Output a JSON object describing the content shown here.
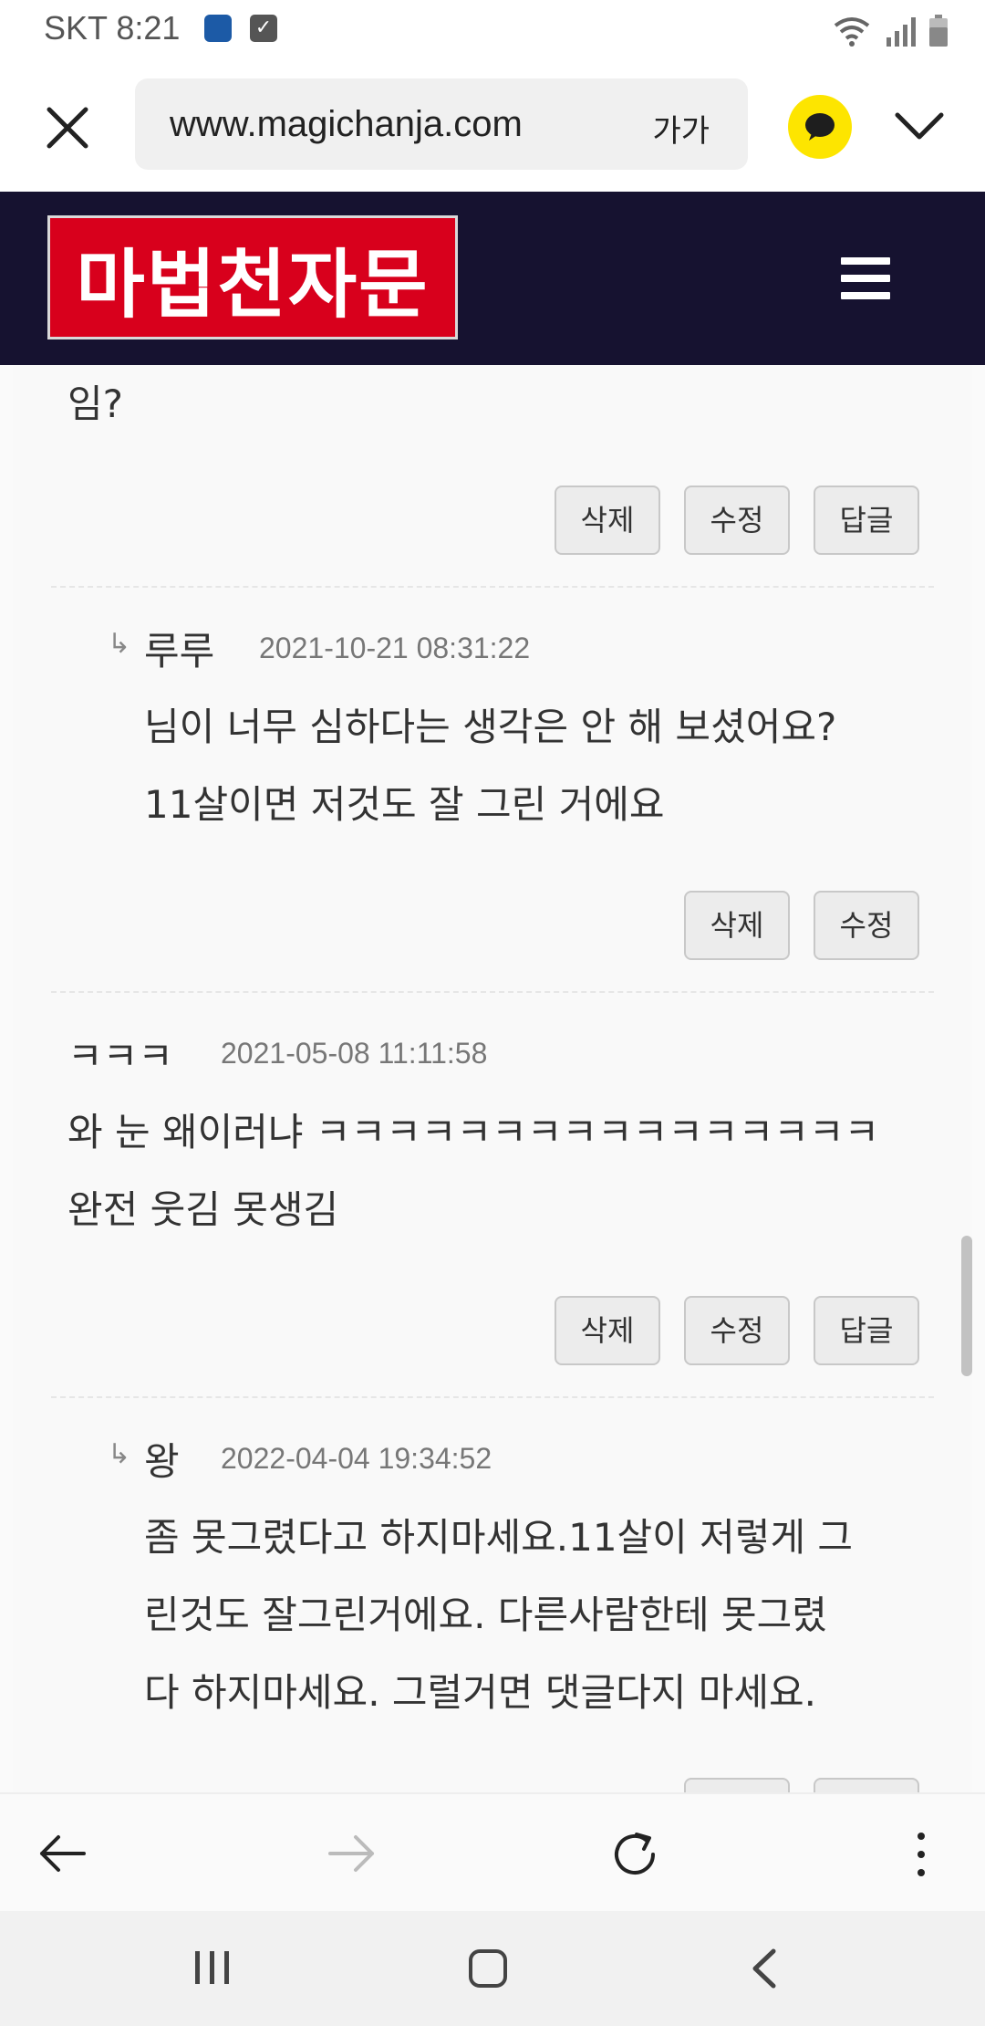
{
  "status": {
    "carrier_time": "SKT 8:21"
  },
  "browser": {
    "url": "www.magichanja.com",
    "text_size_label": "가가"
  },
  "site": {
    "logo_text": "마법천자문"
  },
  "comments": [
    {
      "text_lines": [
        "임?"
      ],
      "buttons": [
        "삭제",
        "수정",
        "답글"
      ]
    },
    {
      "author": "루루",
      "date": "2021-10-21 08:31:22",
      "text_lines": [
        "님이 너무 심하다는 생각은 안 해 보셨어요?",
        "11살이면 저것도 잘 그린 거에요"
      ],
      "buttons": [
        "삭제",
        "수정"
      ]
    },
    {
      "author": "ㅋㅋㅋ",
      "date": "2021-05-08 11:11:58",
      "text_lines": [
        "와 눈 왜이러냐 ㅋㅋㅋㅋㅋㅋㅋㅋㅋㅋㅋㅋㅋㅋㅋㅋ",
        "완전 웃김 못생김"
      ],
      "buttons": [
        "삭제",
        "수정",
        "답글"
      ]
    },
    {
      "author": "왕",
      "date": "2022-04-04 19:34:52",
      "text_lines": [
        "좀 못그렸다고 하지마세요.11살이 저렇게 그",
        "린것도 잘그린거에요. 다른사람한테 못그렸",
        "다 하지마세요. 그럴거면 댓글다지 마세요."
      ]
    }
  ],
  "reply_marker": "↳",
  "colors": {
    "header_bg": "#161230",
    "logo_red": "#d8001c",
    "kakao_yellow": "#fde500"
  }
}
